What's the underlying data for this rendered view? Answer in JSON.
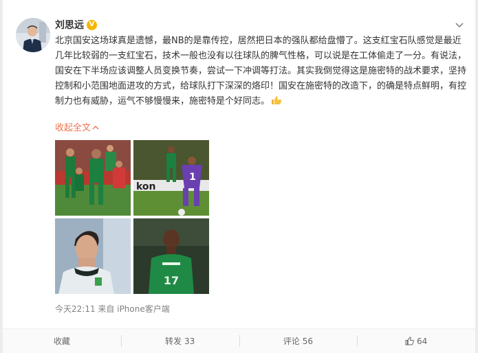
{
  "author": {
    "name": "刘思远",
    "verified_badge": "V"
  },
  "post": {
    "text": "北京国安这场球真是遗憾，最NB的是靠传控，居然把日本的强队都给盘懵了。这支红宝石队感觉是最近几年比较弱的一支红宝石，技术一般也没有以往球队的脾气性格，可以说是在工体偷走了一分。有说法，国安在下半场应该调整人员变换节奏，尝试一下冲调等打法。其实我倒觉得这是施密特的战术要求，坚持控制和小范围地面进攻的方式，给球队打下深深的烙印！国安在施密特的改造下，的确是特点鲜明，有控制力也有威胁，运气不够慢慢来，施密特是个好同志。",
    "emoji": "thumbs-up-icon",
    "collapse_label": "收起全文",
    "timestamp": "今天22:11",
    "source": "来自 iPhone客户端"
  },
  "images": [
    {
      "name": "photo-players-celebrating",
      "jersey": ""
    },
    {
      "name": "photo-goalkeeper-save",
      "jersey": "1"
    },
    {
      "name": "photo-coach-portrait",
      "jersey": ""
    },
    {
      "name": "photo-player-17",
      "jersey": "17"
    }
  ],
  "actions": {
    "favorite_label": "收藏",
    "repost_label": "转发",
    "repost_count": "33",
    "comment_label": "评论",
    "comment_count": "56",
    "like_count": "64"
  },
  "colors": {
    "accent": "#eb7350",
    "badge": "#f7b500",
    "jersey_green": "#1f7a3a",
    "pitch_green": "#5a8f3a"
  }
}
